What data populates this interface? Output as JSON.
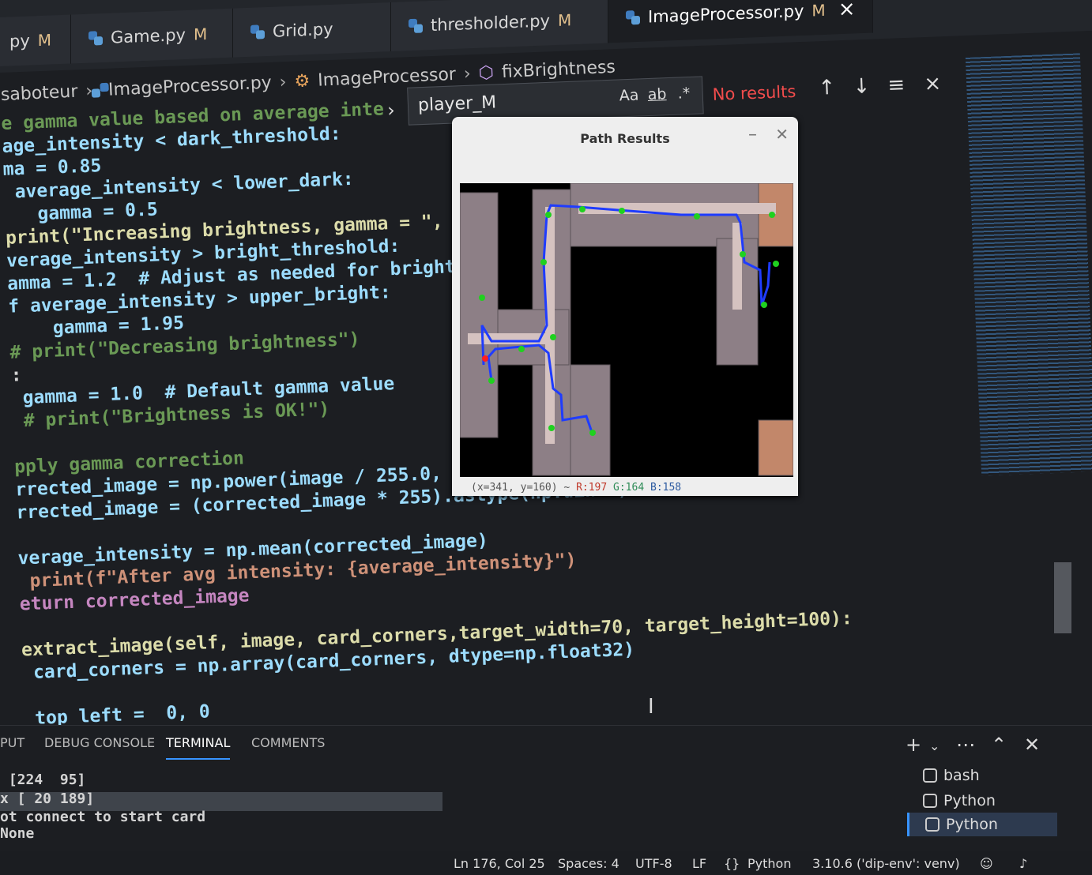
{
  "tabs": [
    {
      "name": "py",
      "modified": "M"
    },
    {
      "name": "Game.py",
      "modified": "M"
    },
    {
      "name": "Grid.py",
      "modified": ""
    },
    {
      "name": "thresholder.py",
      "modified": "M"
    },
    {
      "name": "ImageProcessor.py",
      "modified": "M",
      "active": true
    }
  ],
  "breadcrumb": [
    "saboteur",
    "ImageProcessor.py",
    "ImageProcessor",
    "fixBrightness"
  ],
  "find": {
    "value": "player_M",
    "match_case": "Aa",
    "whole_word": "ab",
    "regex": ".*",
    "status": "No results"
  },
  "code": [
    "e gamma value based on average inte",
    "age_intensity < dark_threshold:",
    "ma = 0.85",
    " average_intensity < lower_dark:",
    "   gamma = 0.5",
    "print(\"Increasing brightness, gamma = \", gam",
    "verage_intensity > bright_threshold:",
    "amma = 1.2  # Adjust as needed for bright ima",
    "f average_intensity > upper_bright:",
    "    gamma = 1.95",
    "# print(\"Decreasing brightness\")",
    ":",
    " gamma = 1.0  # Default gamma value",
    " # print(\"Brightness is OK!\")",
    "",
    "pply gamma correction",
    "rrected_image = np.power(image / 255.0, gamma)",
    "rrected_image = (corrected_image * 255).astype(np.uint8)",
    "",
    "verage_intensity = np.mean(corrected_image)",
    " print(f\"After avg intensity: {average_intensity}\")",
    "eturn corrected_image",
    "",
    "extract_image(self, image, card_corners,target_width=70, target_height=100):",
    " card_corners = np.array(card_corners, dtype=np.float32)",
    "",
    " top_left =  0, 0"
  ],
  "popup": {
    "title": "Path Results",
    "status": {
      "coords": "(x=341, y=160) ~",
      "r": "R:197",
      "g": "G:164",
      "b": "B:158"
    }
  },
  "panel": {
    "tabs": [
      "PUT",
      "DEBUG CONSOLE",
      "TERMINAL",
      "COMMENTS"
    ],
    "active_tab": "TERMINAL",
    "terminal_lines": [
      " [224  95]",
      "x [ 20 189]",
      "ot connect to start card",
      "None"
    ],
    "terminals": [
      "bash",
      "Python",
      "Python"
    ]
  },
  "statusbar": {
    "position": "Ln 176, Col 25",
    "spaces": "Spaces: 4",
    "encoding": "UTF-8",
    "eol": "LF",
    "language": "Python",
    "interpreter": "3.10.6 ('dip-env': venv)"
  },
  "colors": {
    "accent": "#3794ff",
    "error": "#f14c4c",
    "path_line": "#1f3cff",
    "path_node": "#1fd11f"
  }
}
